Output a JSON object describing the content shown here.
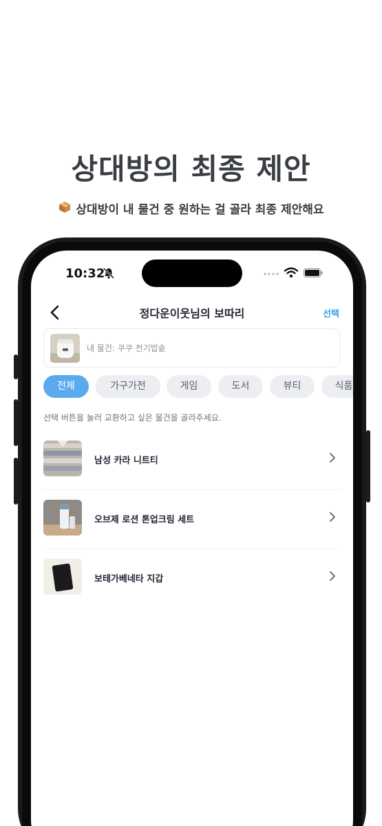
{
  "promo": {
    "title": "상대방의 최종 제안",
    "subtitle": "상대방이 내 물건 중 원하는 걸 골라 최종 제안해요",
    "subtitle_icon": "package-box-icon"
  },
  "status_bar": {
    "time": "10:32"
  },
  "nav": {
    "title": "정다운이웃님의 보따리",
    "action": "선택"
  },
  "my_item": {
    "label": "내 물건: 쿠쿠 전기밥솥"
  },
  "categories": [
    "전체",
    "가구가전",
    "게임",
    "도서",
    "뷰티",
    "식품"
  ],
  "selected_category": "전체",
  "hint": "선택 버튼을 눌러 교환하고 싶은 물건을 골라주세요.",
  "items": [
    {
      "name": "남성 카라 니트티"
    },
    {
      "name": "오브제 로션 톤업크림 세트"
    },
    {
      "name": "보테가베네타 지갑"
    }
  ],
  "colors": {
    "accent": "#5aaaf0",
    "link": "#3aa0ee",
    "title": "#3a3d44"
  }
}
